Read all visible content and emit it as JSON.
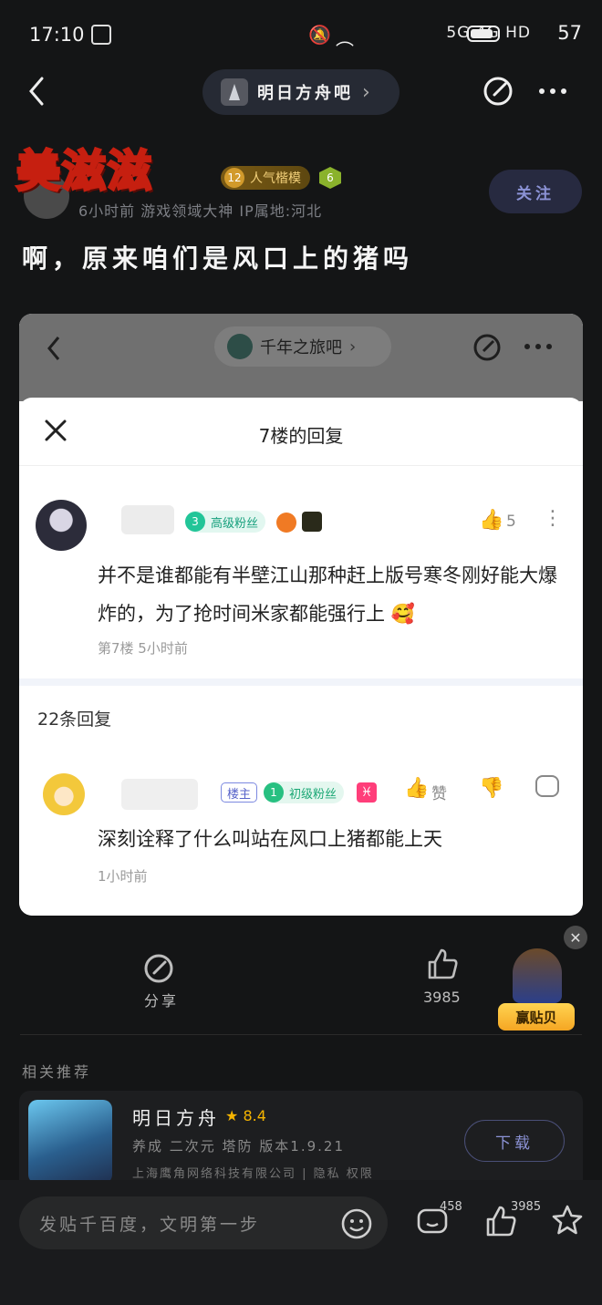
{
  "status": {
    "time": "17:10",
    "signal_text": "5G 4G HD",
    "battery": "57"
  },
  "nav": {
    "forum_name": "明日方舟吧",
    "chevron": "›"
  },
  "post": {
    "username": "美滋滋",
    "level_num": "12",
    "level_title": "人气楷模",
    "level_icon_num": "6",
    "meta": "6小时前  游戏领域大神  IP属地:河北",
    "follow_label": "关注",
    "title": "啊，原来咱们是风口上的猪吗"
  },
  "screenshot": {
    "forum_name": "千年之旅吧",
    "modal_title": "7楼的回复",
    "comment": {
      "fan_level": "3",
      "fan_label": "高级粉丝",
      "like_count": "5",
      "text": "并不是谁都能有半壁江山那种赶上版号寒冬刚好能大爆炸的，为了抢时间米家都能强行上 🥰",
      "meta": "第7楼  5小时前"
    },
    "reply_count": "22条回复",
    "reply": {
      "host_tag": "楼主",
      "fan_level": "1",
      "fan_label": "初级粉丝",
      "zodiac": "♓",
      "like_label": "赞",
      "text": "深刻诠释了什么叫站在风口上猪都能上天",
      "meta": "1小时前"
    }
  },
  "actions": {
    "share_label": "分享",
    "like_count": "3985",
    "promo_label": "赢贴贝"
  },
  "recommend": {
    "section_title": "相关推荐",
    "app_name": "明日方舟",
    "rating": "8.4",
    "tags": "养成 二次元 塔防  版本1.9.21",
    "company": "上海鹰角网络科技有限公司 | 隐私 权限",
    "download_label": "下载"
  },
  "bottom": {
    "placeholder": "发贴千百度，文明第一步",
    "comment_count": "458",
    "like_count": "3985"
  },
  "colors": {
    "accent": "#8c93d6",
    "bg": "#141516",
    "gold": "#f5b400"
  }
}
